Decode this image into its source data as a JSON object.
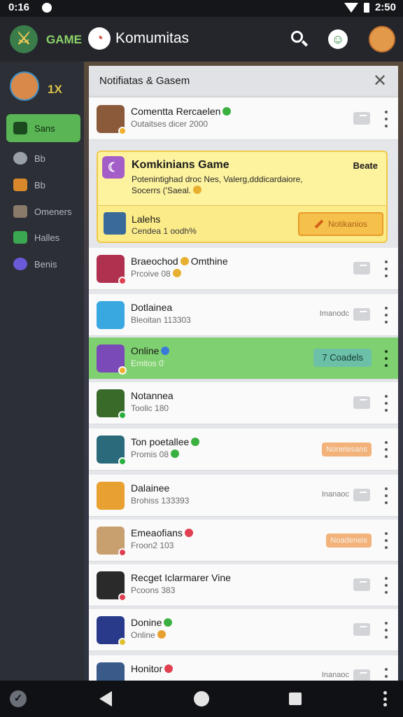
{
  "status_bar": {
    "time": "0:16",
    "battery_text": "2:50"
  },
  "app_bar": {
    "app_name": "GAME",
    "title": "Komumitas"
  },
  "sidebar": {
    "level": "1X",
    "items": [
      {
        "label": "Sans",
        "icon": "bag-icon",
        "active": true,
        "color": "#1b4a1e"
      },
      {
        "label": "Bb",
        "icon": "pencil-icon",
        "active": false,
        "color": "#9aa0a8"
      },
      {
        "label": "Bb",
        "icon": "chart-icon",
        "active": false,
        "color": "#d8882a"
      },
      {
        "label": "Omeners",
        "icon": "crossed-swords-icon",
        "active": false,
        "color": "#8a7a6a"
      },
      {
        "label": "Halles",
        "icon": "x-box-icon",
        "active": false,
        "color": "#3aa850"
      },
      {
        "label": "Benis",
        "icon": "feather-icon",
        "active": false,
        "color": "#6a5ad8"
      }
    ]
  },
  "panel": {
    "title": "Notifiatas & Gasem",
    "rows_top": {
      "name": "Comentta Rercaelen",
      "sub": "Outaitses dicer 2000",
      "avatar_color": "#8a5a3a",
      "dot_color": "#f0b02a"
    },
    "feature": {
      "title": "Komkinians Game",
      "tag": "Beate",
      "desc_line1": "Potenintighad droc Nes, Valerg,dddicardaiore,",
      "desc_line2": "Socerrs ('Saeal.",
      "user": "Lalehs",
      "user_sub": "Cendea 1 oodh%",
      "button_label": "Notikanios"
    },
    "rows": [
      {
        "name": "Braeochod",
        "name_suffix": "Omthine",
        "sub": "Prcoive 08",
        "avatar_color": "#b03050",
        "dot_color": "#e04050",
        "emoji_name": "#e8b030",
        "emoji_sub": "#e8b030",
        "right": "gray",
        "side_text": "",
        "online": false
      },
      {
        "name": "Dotlainea",
        "name_suffix": "",
        "sub": "Bleoitan 113303",
        "avatar_color": "#3aa8e0",
        "dot_color": "",
        "emoji_name": "",
        "emoji_sub": "",
        "right": "gray",
        "side_text": "Imanodc",
        "online": false
      },
      {
        "name": "Online",
        "name_suffix": "",
        "sub": "Emitos 0̈",
        "avatar_color": "#7a4ab8",
        "dot_color": "#f0b02a",
        "emoji_name": "#3a7ad8",
        "emoji_sub": "",
        "right": "teal",
        "badge_text": "7 Coadels",
        "side_text": "",
        "online": true
      },
      {
        "name": "Notannea",
        "name_suffix": "",
        "sub": "Toolic 180",
        "avatar_color": "#3a6a2a",
        "dot_color": "#2ab040",
        "emoji_name": "",
        "emoji_sub": "",
        "right": "gray",
        "side_text": "",
        "online": false
      },
      {
        "name": "Ton poetallee",
        "name_suffix": "",
        "sub": "Promis 08",
        "avatar_color": "#2a6a7a",
        "dot_color": "#2ab040",
        "emoji_name": "#3ab040",
        "emoji_sub": "#3ab040",
        "right": "orange",
        "badge_text": "Nonetesans",
        "side_text": "",
        "online": false
      },
      {
        "name": "Dalainee",
        "name_suffix": "",
        "sub": "Brohiss 133393",
        "avatar_color": "#e8a030",
        "dot_color": "",
        "emoji_name": "",
        "emoji_sub": "",
        "right": "gray",
        "side_text": "Inanaoc",
        "online": false
      },
      {
        "name": "Emeaofians",
        "name_suffix": "",
        "sub": "Froon2 103",
        "avatar_color": "#c8a070",
        "dot_color": "#e04050",
        "emoji_name": "#e04050",
        "emoji_sub": "",
        "right": "orange",
        "badge_text": "Noadeneis",
        "side_text": "",
        "online": false
      },
      {
        "name": "Recget Iclarmarer Vine",
        "name_suffix": "",
        "sub": "Pcoons 383",
        "avatar_color": "#2a2a2a",
        "dot_color": "#e04050",
        "emoji_name": "",
        "emoji_sub": "",
        "right": "gray",
        "side_text": "",
        "online": false
      },
      {
        "name": "Donine",
        "name_suffix": "",
        "sub": "Online",
        "avatar_color": "#2a3a8a",
        "dot_color": "#e0c030",
        "emoji_name": "#3ab040",
        "emoji_sub": "#e8a030",
        "right": "gray",
        "side_text": "",
        "online": false
      },
      {
        "name": "Honitor",
        "name_suffix": "",
        "sub": "",
        "avatar_color": "#3a5a8a",
        "dot_color": "",
        "emoji_name": "#e04050",
        "emoji_sub": "",
        "right": "gray",
        "side_text": "Inanaoc",
        "online": false
      }
    ]
  },
  "colors": {
    "accent_green": "#5ab554",
    "online_row": "#7fd070",
    "feature_yellow": "#fbeb89",
    "badge_orange": "#f3b27a",
    "badge_teal": "#6cc0a8"
  }
}
